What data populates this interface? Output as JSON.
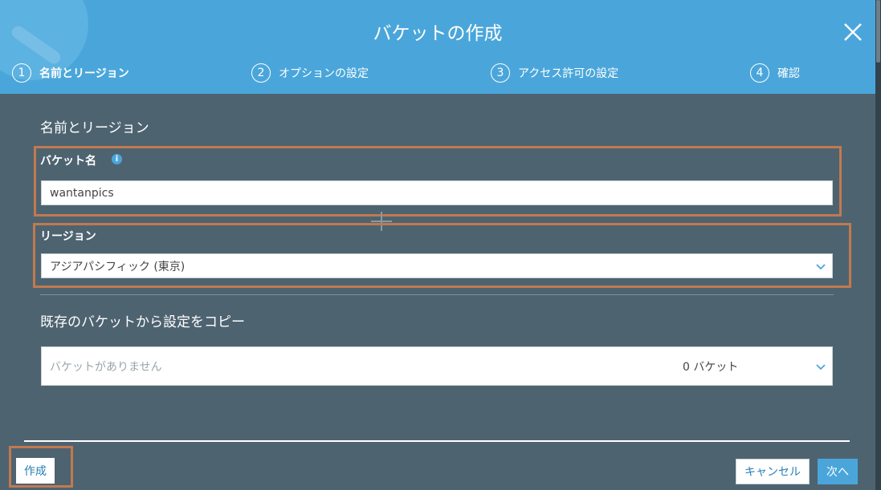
{
  "header": {
    "title": "バケットの作成",
    "close_icon": "close-icon",
    "steps": [
      {
        "number": "1",
        "label": "名前とリージョン",
        "active": true
      },
      {
        "number": "2",
        "label": "オプションの設定",
        "active": false
      },
      {
        "number": "3",
        "label": "アクセス許可の設定",
        "active": false
      },
      {
        "number": "4",
        "label": "確認",
        "active": false
      }
    ]
  },
  "form": {
    "section_title": "名前とリージョン",
    "bucket_name": {
      "label": "バケット名",
      "info_icon": "i",
      "value": "wantanpics"
    },
    "region": {
      "label": "リージョン",
      "selected": "アジアパシフィック (東京)"
    },
    "copy_settings": {
      "title": "既存のバケットから設定をコピー",
      "placeholder": "バケットがありません",
      "count": "0 バケット"
    }
  },
  "footer": {
    "create_label": "作成",
    "cancel_label": "キャンセル",
    "next_label": "次へ"
  },
  "colors": {
    "header_bg": "#4aa6da",
    "body_bg": "#4e6370",
    "accent": "#4aa6da",
    "highlight": "#c07a4f"
  }
}
